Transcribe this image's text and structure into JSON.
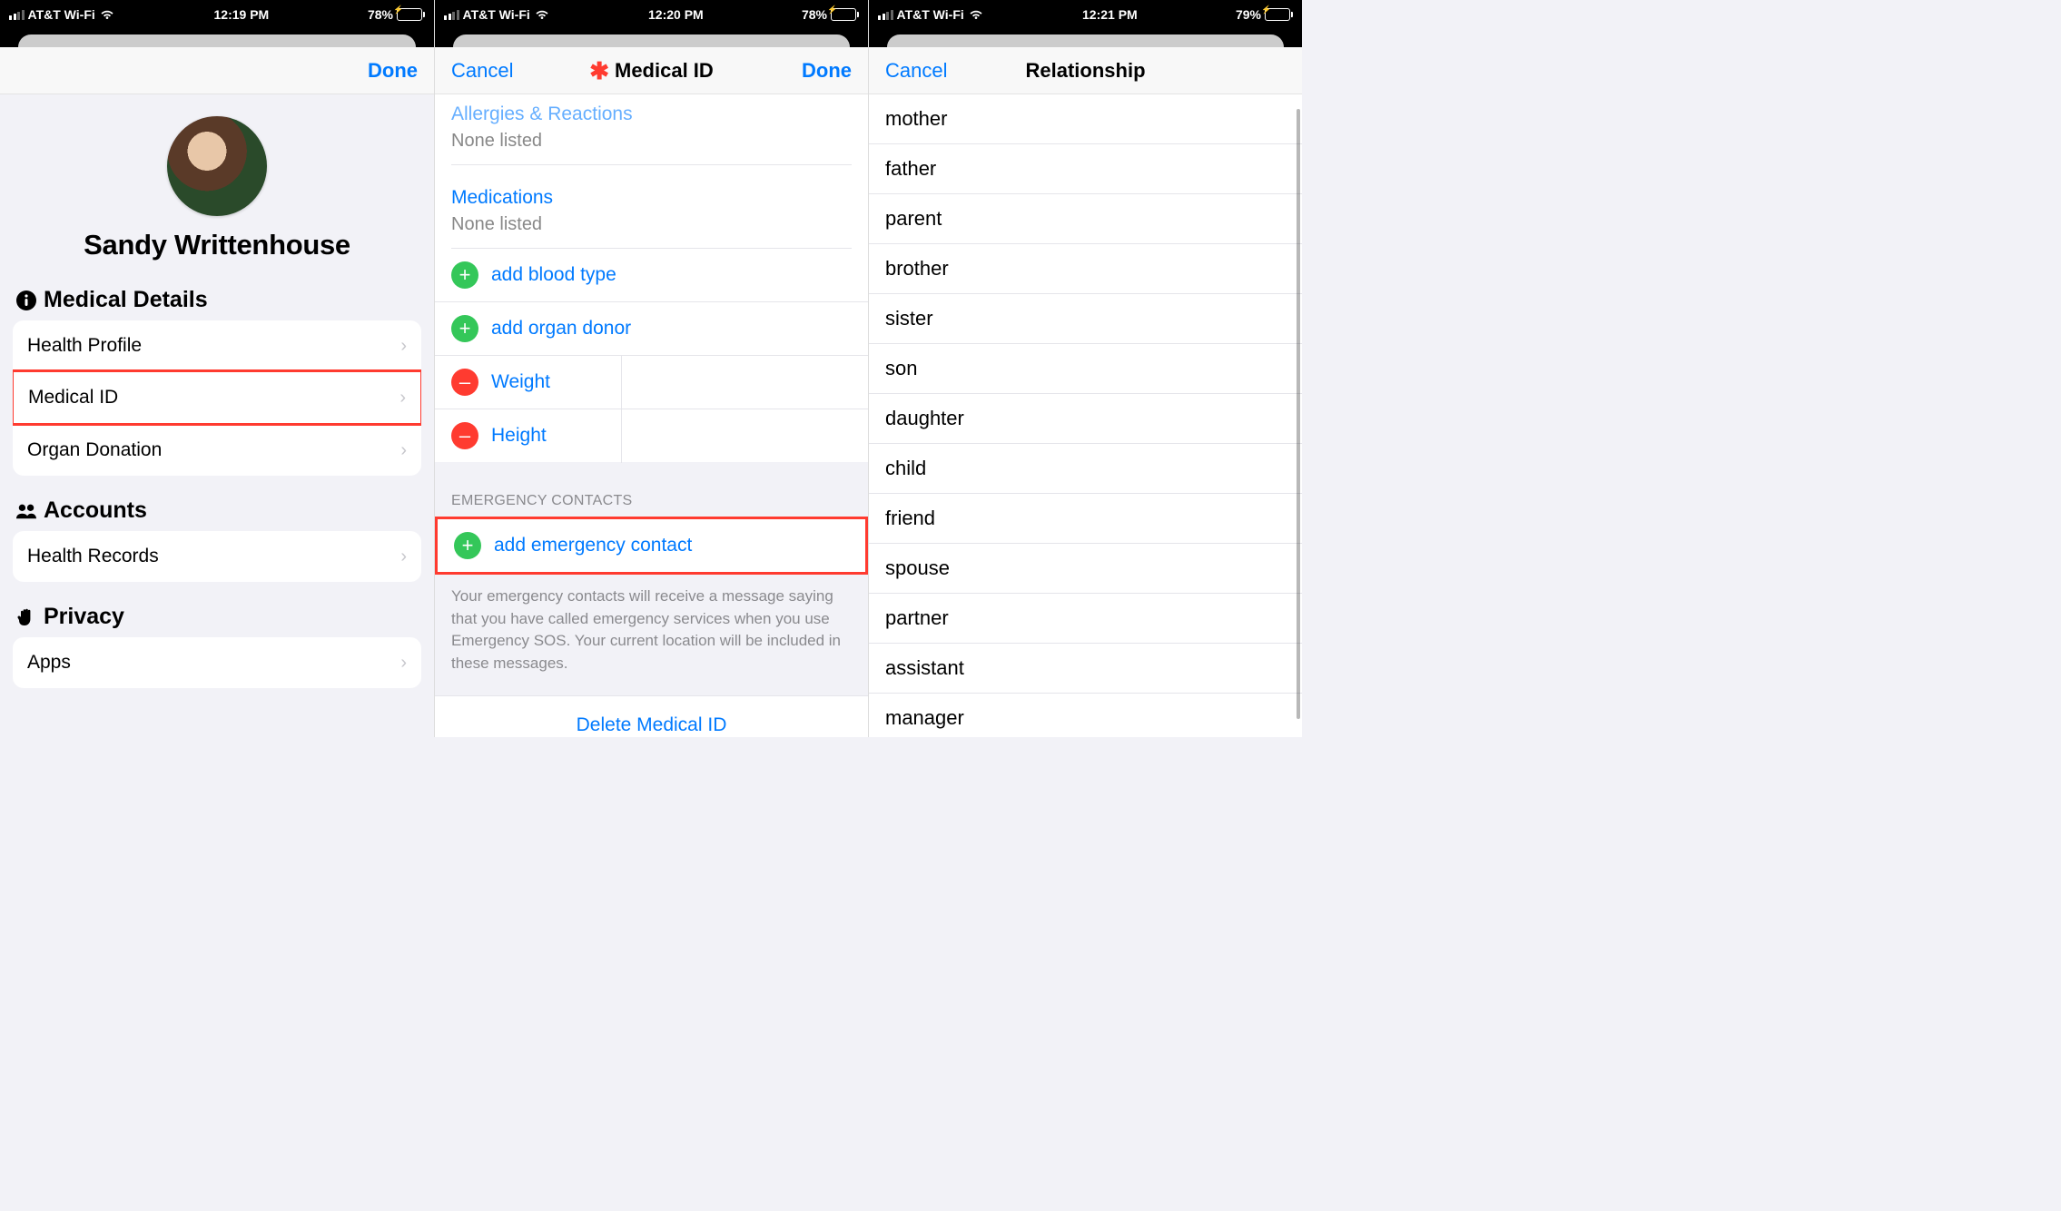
{
  "colors": {
    "blue": "#007aff",
    "red": "#ff3b30",
    "green": "#34c759",
    "gray_bg": "#f2f2f7"
  },
  "status1": {
    "carrier": "AT&T Wi-Fi",
    "time": "12:19 PM",
    "battery": "78%"
  },
  "status2": {
    "carrier": "AT&T Wi-Fi",
    "time": "12:20 PM",
    "battery": "78%"
  },
  "status3": {
    "carrier": "AT&T Wi-Fi",
    "time": "12:21 PM",
    "battery": "79%"
  },
  "screen1": {
    "nav": {
      "done": "Done"
    },
    "profile_name": "Sandy Writtenhouse",
    "groups": [
      {
        "title": "Medical Details",
        "icon": "info",
        "items": [
          "Health Profile",
          "Medical ID",
          "Organ Donation"
        ],
        "highlight_index": 1
      },
      {
        "title": "Accounts",
        "icon": "people",
        "items": [
          "Health Records"
        ]
      },
      {
        "title": "Privacy",
        "icon": "hand",
        "items": [
          "Apps"
        ]
      }
    ]
  },
  "screen2": {
    "nav": {
      "cancel": "Cancel",
      "title": "Medical ID",
      "done": "Done"
    },
    "allergies_label": "Allergies & Reactions",
    "allergies_value": "None listed",
    "medications_label": "Medications",
    "medications_value": "None listed",
    "add_rows": [
      {
        "kind": "add",
        "label": "add blood type"
      },
      {
        "kind": "add",
        "label": "add organ donor"
      },
      {
        "kind": "remove",
        "label": "Weight"
      },
      {
        "kind": "remove",
        "label": "Height"
      }
    ],
    "ec_header": "EMERGENCY CONTACTS",
    "ec_add": "add emergency contact",
    "ec_footer": "Your emergency contacts will receive a message saying that you have called emergency services when you use Emergency SOS. Your current location will be included in these messages.",
    "delete": "Delete Medical ID"
  },
  "screen3": {
    "nav": {
      "cancel": "Cancel",
      "title": "Relationship"
    },
    "options": [
      "mother",
      "father",
      "parent",
      "brother",
      "sister",
      "son",
      "daughter",
      "child",
      "friend",
      "spouse",
      "partner",
      "assistant",
      "manager"
    ]
  }
}
